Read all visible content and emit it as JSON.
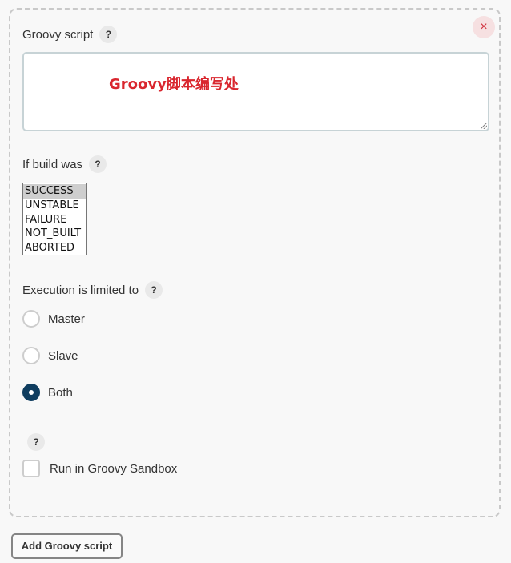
{
  "close": {
    "glyph": "×"
  },
  "groovy_script": {
    "label": "Groovy script",
    "help": "?",
    "value": "Groovy脚本编写处"
  },
  "build_status": {
    "label": "If build was",
    "help": "?",
    "options": [
      "SUCCESS",
      "UNSTABLE",
      "FAILURE",
      "NOT_BUILT",
      "ABORTED"
    ],
    "selected": "SUCCESS"
  },
  "execution": {
    "label": "Execution is limited to",
    "help": "?",
    "options": [
      "Master",
      "Slave",
      "Both"
    ],
    "selected": "Both"
  },
  "sandbox": {
    "help": "?",
    "label": "Run in Groovy Sandbox",
    "checked": false
  },
  "add_button": {
    "label": "Add Groovy script"
  },
  "colors": {
    "accent": "#0f3d5f",
    "close": "#d0313d",
    "script_text": "#d9262e"
  }
}
